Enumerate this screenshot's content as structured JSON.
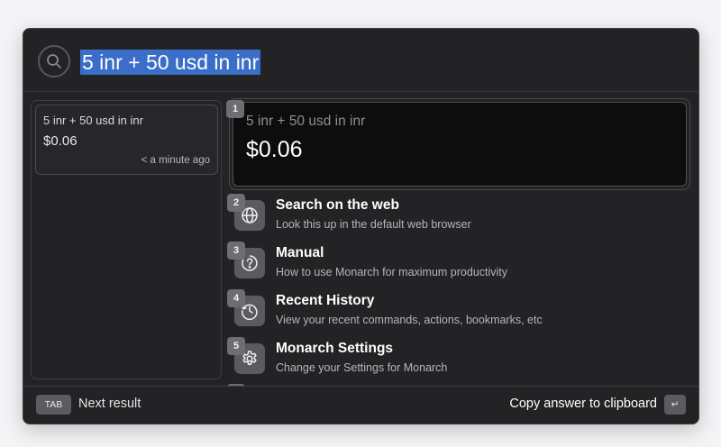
{
  "search": {
    "query": "5 inr + 50 usd in inr"
  },
  "history": {
    "items": [
      {
        "query": "5 inr + 50 usd in inr",
        "answer": "$0.06",
        "time": "< a minute ago"
      }
    ]
  },
  "answer": {
    "badge": "1",
    "query": "5 inr + 50 usd in inr",
    "value": "$0.06"
  },
  "results": [
    {
      "badge": "2",
      "icon": "globe-icon",
      "title": "Search on the web",
      "subtitle": "Look this up in the default web browser"
    },
    {
      "badge": "3",
      "icon": "help-icon",
      "title": "Manual",
      "subtitle": "How to use Monarch for maximum productivity"
    },
    {
      "badge": "4",
      "icon": "history-icon",
      "title": "Recent History",
      "subtitle": "View your recent commands, actions, bookmarks, etc"
    },
    {
      "badge": "5",
      "icon": "gear-icon",
      "title": "Monarch Settings",
      "subtitle": "Change your Settings for Monarch"
    }
  ],
  "footer": {
    "tab_key": "TAB",
    "next_label": "Next result",
    "copy_label": "Copy answer to clipboard",
    "enter_key": "↵"
  },
  "colors": {
    "window_bg": "#232325",
    "selection": "#3a6ec8",
    "answer_bg": "#0d0d0e"
  }
}
